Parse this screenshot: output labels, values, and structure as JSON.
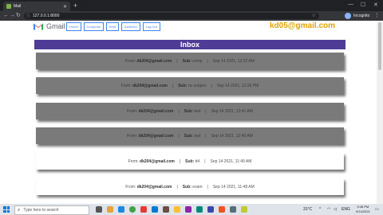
{
  "browser": {
    "tab_title": "Mail",
    "new_tab_glyph": "+",
    "url": "127.0.0.1:8000",
    "profile_name": "Incognito",
    "window_controls": [
      "—",
      "☐",
      "✕"
    ]
  },
  "app": {
    "logo_text": "Gmail",
    "nav": [
      "Home",
      "Compose",
      "Sent",
      "Archived",
      "Log Out"
    ],
    "user_email": "kd05@gmail.com",
    "inbox_title": "Inbox"
  },
  "emails": [
    {
      "from_label": "From:",
      "from": "dk204@gmail.com",
      "subj_label": "Sub:",
      "subject": "comp",
      "date": "Sep 14 2021, 12:22 AM",
      "read": true
    },
    {
      "from_label": "From:",
      "from": "dk204@gmail.com",
      "subj_label": "Sub:",
      "subject": "no subject",
      "date": "Sep 14 2021, 12:26 PM",
      "read": true
    },
    {
      "from_label": "From:",
      "from": "dk204@gmail.com",
      "subj_label": "Sub:",
      "subject": "test",
      "date": "Sep 14 2021, 12:41 AM",
      "read": true
    },
    {
      "from_label": "From:",
      "from": "dk204@gmail.com",
      "subj_label": "Sub:",
      "subject": "test",
      "date": "Sep 14 2021, 12:40 AM",
      "read": true
    },
    {
      "from_label": "From:",
      "from": "dk204@gmail.com",
      "subj_label": "Sub:",
      "subject": "tt4",
      "date": "Sep 14 2021, 11:49 AM",
      "read": false
    },
    {
      "from_label": "From:",
      "from": "dk204@gmail.com",
      "subj_label": "Sub:",
      "subject": "exam",
      "date": "Sep 14 2021, 11:48 AM",
      "read": false
    }
  ],
  "taskbar": {
    "search_placeholder": "Type here to search",
    "weather": "31°C",
    "lang": "ENG",
    "time": "5:48 PM",
    "date": "9/14/2021"
  },
  "colors": {
    "inbox_bar": "#4f3c96",
    "email_accent": "#e3a400",
    "nav_border": "#4285f4",
    "read_card": "#7a7a7a"
  }
}
